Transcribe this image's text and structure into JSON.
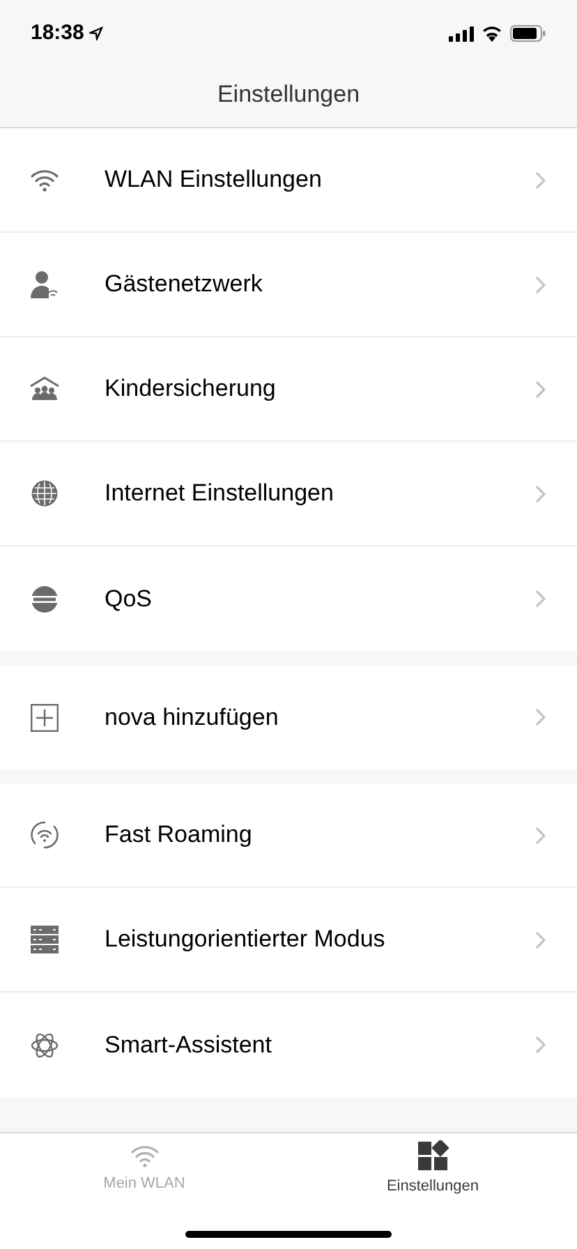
{
  "status_bar": {
    "time": "18:38"
  },
  "header": {
    "title": "Einstellungen"
  },
  "groups": [
    {
      "items": [
        {
          "label": "WLAN Einstellungen"
        },
        {
          "label": "Gästenetzwerk"
        },
        {
          "label": "Kindersicherung"
        },
        {
          "label": "Internet Einstellungen"
        },
        {
          "label": "QoS"
        }
      ]
    },
    {
      "items": [
        {
          "label": "nova hinzufügen"
        }
      ]
    },
    {
      "items": [
        {
          "label": "Fast Roaming"
        },
        {
          "label": "Leistungorientierter Modus"
        },
        {
          "label": "Smart-Assistent"
        }
      ]
    }
  ],
  "tab_bar": [
    {
      "label": "Mein WLAN",
      "selected": false
    },
    {
      "label": "Einstellungen",
      "selected": true
    }
  ]
}
